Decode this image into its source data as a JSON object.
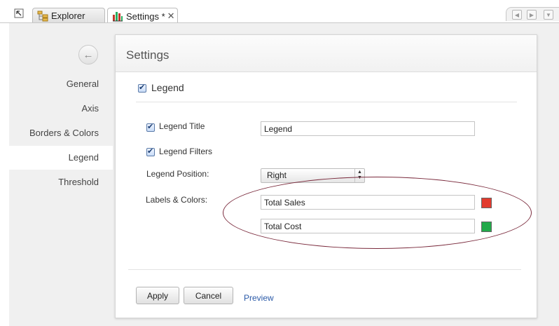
{
  "tabs": {
    "explorer_label": "Explorer",
    "settings_label": "Settings *",
    "close_glyph": "✕"
  },
  "sidebar": {
    "items": [
      {
        "label": "General"
      },
      {
        "label": "Axis"
      },
      {
        "label": "Borders & Colors"
      },
      {
        "label": "Legend",
        "active": true
      },
      {
        "label": "Threshold"
      }
    ]
  },
  "panel": {
    "title": "Settings",
    "legend_section": {
      "label": "Legend",
      "checked": true
    },
    "legend_title": {
      "label": "Legend Title",
      "checked": true,
      "value": "Legend"
    },
    "legend_filters": {
      "label": "Legend Filters",
      "checked": true
    },
    "legend_position": {
      "label": "Legend Position:",
      "selected": "Right"
    },
    "labels_colors": {
      "label": "Labels & Colors:",
      "rows": [
        {
          "value": "Total Sales",
          "color": "#e23b2e"
        },
        {
          "value": "Total Cost",
          "color": "#22a94a"
        }
      ]
    },
    "buttons": {
      "apply": "Apply",
      "cancel": "Cancel",
      "preview": "Preview"
    }
  },
  "annotation_color": "#7a2a3c"
}
